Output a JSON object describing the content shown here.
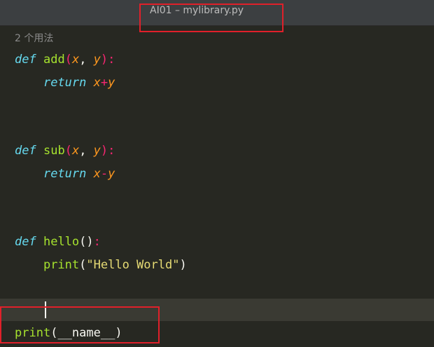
{
  "window": {
    "title": "AI01 – mylibrary.py"
  },
  "editor": {
    "usage_hint": "2 个用法",
    "lines": [
      {
        "keyword": "def",
        "name": "add",
        "open": "(",
        "p1": "x",
        "comma": ", ",
        "p2": "y",
        "close": "):"
      },
      {
        "keyword": "return",
        "a": "x",
        "op": "+",
        "b": "y"
      },
      {
        "keyword": "def",
        "name": "sub",
        "open": "(",
        "p1": "x",
        "comma": ", ",
        "p2": "y",
        "close": "):"
      },
      {
        "keyword": "return",
        "a": "x",
        "op": "-",
        "b": "y"
      },
      {
        "keyword": "def",
        "name": "hello",
        "parens": "()",
        "colon": ":"
      },
      {
        "call": "print",
        "open": "(",
        "arg": "\"Hello World\"",
        "close": ")"
      },
      {
        "call": "print",
        "open": "(",
        "arg": "__name__",
        "close": ")"
      }
    ]
  },
  "colors": {
    "background": "#272822",
    "keyword": "#66d9ef",
    "function": "#a6e22e",
    "parameter": "#fd971f",
    "operator": "#f92672",
    "string": "#e6db74",
    "annotation_box": "#e0202a"
  }
}
